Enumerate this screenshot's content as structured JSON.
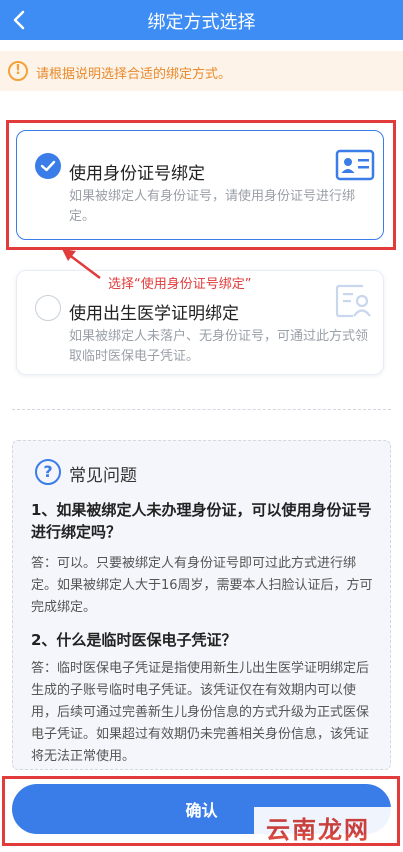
{
  "header": {
    "title": "绑定方式选择"
  },
  "notice": {
    "icon": "warning-circle-icon",
    "text": "请根据说明选择合适的绑定方式。"
  },
  "options": [
    {
      "title": "使用身份证号绑定",
      "description": "如果被绑定人有身份证号，请使用身份证号进行绑定。",
      "selected": true,
      "icon": "id-card-icon"
    },
    {
      "title": "使用出生医学证明绑定",
      "description": "如果被绑定人未落户、无身份证号，可通过此方式领取临时医保电子凭证。",
      "selected": false,
      "icon": "certificate-icon"
    }
  ],
  "annotation": {
    "text": "选择“使用身份证号绑定”"
  },
  "faq": {
    "heading": "常见问题",
    "items": [
      {
        "question": "1、如果被绑定人未办理身份证，可以使用身份证号进行绑定吗？",
        "answer": "答：可以。只要被绑定人有身份证号即可过此方式进行绑定。如果被绑定人大于16周岁，需要本人扫脸认证后，方可完成绑定。"
      },
      {
        "question": "2、什么是临时医保电子凭证？",
        "answer": "答：临时医保电子凭证是指使用新生儿出生医学证明绑定后生成的子账号临时电子凭证。该凭证仅在有效期内可以使用，后续可通过完善新生儿身份信息的方式升级为正式医保电子凭证。如果超过有效期仍未完善相关身份信息，该凭证将无法正常使用。"
      }
    ]
  },
  "confirm_label": "确认",
  "watermark": "云南龙网",
  "colors": {
    "primary": "#3b7de8",
    "header": "#3d8df5",
    "notice_bg": "#fdf3e8",
    "notice_text": "#e88a2c",
    "annotation": "#e23b3b"
  }
}
